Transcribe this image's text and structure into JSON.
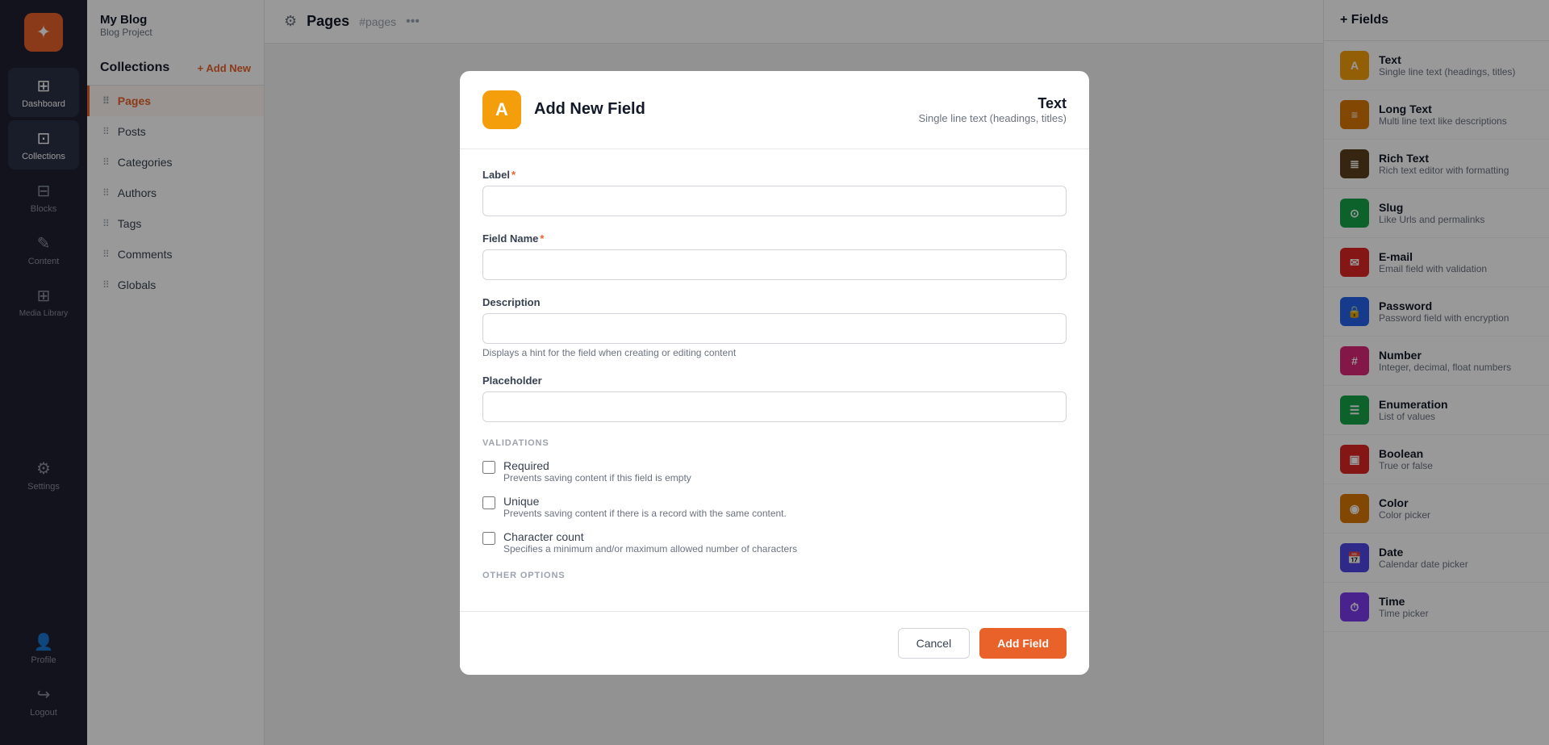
{
  "app": {
    "name": "My Blog",
    "subtitle": "Blog Project",
    "logo_symbol": "✦"
  },
  "sidebar": {
    "items": [
      {
        "id": "dashboard",
        "label": "Dashboard",
        "icon": "⊞"
      },
      {
        "id": "collections",
        "label": "Collections",
        "icon": "⊡",
        "active": true
      },
      {
        "id": "blocks",
        "label": "Blocks",
        "icon": "⊟"
      },
      {
        "id": "content",
        "label": "Content",
        "icon": "✎"
      },
      {
        "id": "media",
        "label": "Media Library",
        "icon": "⊞"
      },
      {
        "id": "settings",
        "label": "Settings",
        "icon": "⚙"
      }
    ],
    "bottom_items": [
      {
        "id": "profile",
        "label": "Profile",
        "icon": "👤"
      },
      {
        "id": "logout",
        "label": "Logout",
        "icon": "↪"
      }
    ]
  },
  "collections": {
    "title": "Collections",
    "add_button": "+ Add New",
    "items": [
      {
        "id": "pages",
        "label": "Pages",
        "active": true
      },
      {
        "id": "posts",
        "label": "Posts"
      },
      {
        "id": "categories",
        "label": "Categories"
      },
      {
        "id": "authors",
        "label": "Authors"
      },
      {
        "id": "tags",
        "label": "Tags"
      },
      {
        "id": "comments",
        "label": "Comments"
      },
      {
        "id": "globals",
        "label": "Globals"
      }
    ]
  },
  "main_header": {
    "page_title": "Pages",
    "page_slug": "#pages",
    "gear_icon": "⚙"
  },
  "modal": {
    "icon_letter": "A",
    "title": "Add New Field",
    "type_name": "Text",
    "type_desc": "Single line text (headings, titles)",
    "label_field": {
      "label": "Label",
      "required": true,
      "placeholder": ""
    },
    "field_name": {
      "label": "Field Name",
      "required": true,
      "placeholder": ""
    },
    "description": {
      "label": "Description",
      "placeholder": "",
      "hint": "Displays a hint for the field when creating or editing content"
    },
    "placeholder_field": {
      "label": "Placeholder",
      "placeholder": ""
    },
    "validations_title": "VALIDATIONS",
    "validations": [
      {
        "id": "required",
        "label": "Required",
        "description": "Prevents saving content if this field is empty",
        "checked": false
      },
      {
        "id": "unique",
        "label": "Unique",
        "description": "Prevents saving content if there is a record with the same content.",
        "checked": false
      },
      {
        "id": "character_count",
        "label": "Character count",
        "description": "Specifies a minimum and/or maximum allowed number of characters",
        "checked": false
      }
    ],
    "other_options_title": "OTHER OPTIONS",
    "cancel_button": "Cancel",
    "add_button": "Add Field"
  },
  "fields_panel": {
    "header": "+ Fields",
    "types": [
      {
        "id": "text",
        "name": "Text",
        "desc": "Single line text (headings, titles)",
        "icon_bg": "#f59e0b",
        "icon": "A"
      },
      {
        "id": "long_text",
        "name": "Long Text",
        "desc": "Multi line text like descriptions",
        "icon_bg": "#d97706",
        "icon": "≡"
      },
      {
        "id": "rich_text",
        "name": "Rich Text",
        "desc": "Rich text editor with formatting",
        "icon_bg": "#5a3e1b",
        "icon": "≣"
      },
      {
        "id": "slug",
        "name": "Slug",
        "desc": "Like Urls and permalinks",
        "icon_bg": "#16a34a",
        "icon": "⊙"
      },
      {
        "id": "email",
        "name": "E-mail",
        "desc": "Email field with validation",
        "icon_bg": "#dc2626",
        "icon": "✉"
      },
      {
        "id": "password",
        "name": "Password",
        "desc": "Password field with encryption",
        "icon_bg": "#2563eb",
        "icon": "🔒"
      },
      {
        "id": "number",
        "name": "Number",
        "desc": "Integer, decimal, float numbers",
        "icon_bg": "#db2777",
        "icon": "#"
      },
      {
        "id": "enumeration",
        "name": "Enumeration",
        "desc": "List of values",
        "icon_bg": "#16a34a",
        "icon": "☰"
      },
      {
        "id": "boolean",
        "name": "Boolean",
        "desc": "True or false",
        "icon_bg": "#dc2626",
        "icon": "▣"
      },
      {
        "id": "color",
        "name": "Color",
        "desc": "Color picker",
        "icon_bg": "#d97706",
        "icon": "◉"
      },
      {
        "id": "date",
        "name": "Date",
        "desc": "Calendar date picker",
        "icon_bg": "#4f46e5",
        "icon": "📅"
      },
      {
        "id": "time",
        "name": "Time",
        "desc": "Time picker",
        "icon_bg": "#7c3aed",
        "icon": "⏱"
      }
    ]
  }
}
